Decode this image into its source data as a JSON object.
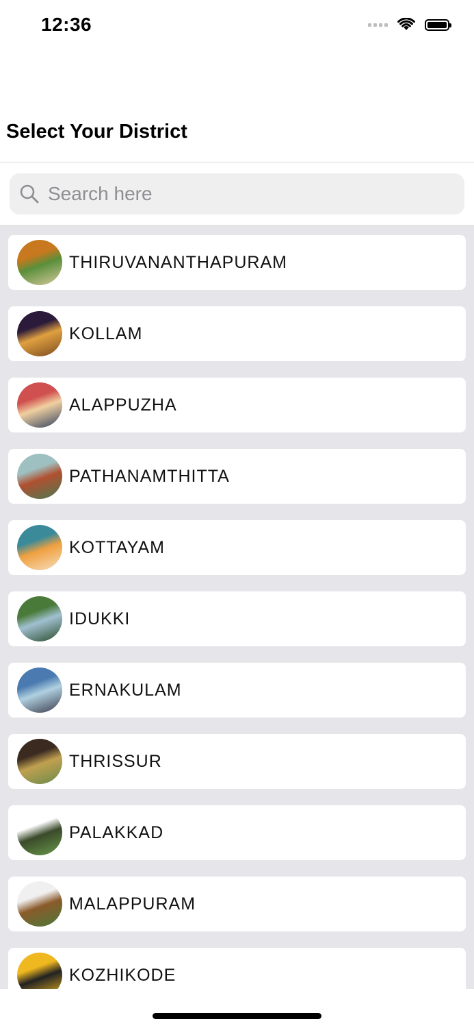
{
  "status_bar": {
    "time": "12:36"
  },
  "header": {
    "title": "Select Your District"
  },
  "search": {
    "placeholder": "Search here",
    "value": ""
  },
  "districts": [
    {
      "name": "THIRUVANANTHAPURAM",
      "thumb_colors": [
        "#c8781e",
        "#5a8f3a",
        "#d9c9a0"
      ]
    },
    {
      "name": "KOLLAM",
      "thumb_colors": [
        "#2b1a3a",
        "#e0a040",
        "#7a4a20"
      ]
    },
    {
      "name": "ALAPPUZHA",
      "thumb_colors": [
        "#d05050",
        "#f0d0a0",
        "#304060"
      ]
    },
    {
      "name": "PATHANAMTHITTA",
      "thumb_colors": [
        "#9fc0c0",
        "#b05030",
        "#4a7a50"
      ]
    },
    {
      "name": "KOTTAYAM",
      "thumb_colors": [
        "#3a8a9a",
        "#f0a040",
        "#f5e0c0"
      ]
    },
    {
      "name": "IDUKKI",
      "thumb_colors": [
        "#4a7a3a",
        "#a0c0d0",
        "#2a4a2a"
      ]
    },
    {
      "name": "ERNAKULAM",
      "thumb_colors": [
        "#4a7ab0",
        "#b0d0e0",
        "#3a3a4a"
      ]
    },
    {
      "name": "THRISSUR",
      "thumb_colors": [
        "#3a2a20",
        "#c0a050",
        "#6a8a4a"
      ]
    },
    {
      "name": "PALAKKAD",
      "thumb_colors": [
        "#ffffff",
        "#3a4a2a",
        "#6a9a4a"
      ]
    },
    {
      "name": "MALAPPURAM",
      "thumb_colors": [
        "#f0f0f0",
        "#8a5a2a",
        "#4a7a3a"
      ]
    },
    {
      "name": "KOZHIKODE",
      "thumb_colors": [
        "#f0b820",
        "#222222",
        "#f0b820"
      ]
    }
  ]
}
